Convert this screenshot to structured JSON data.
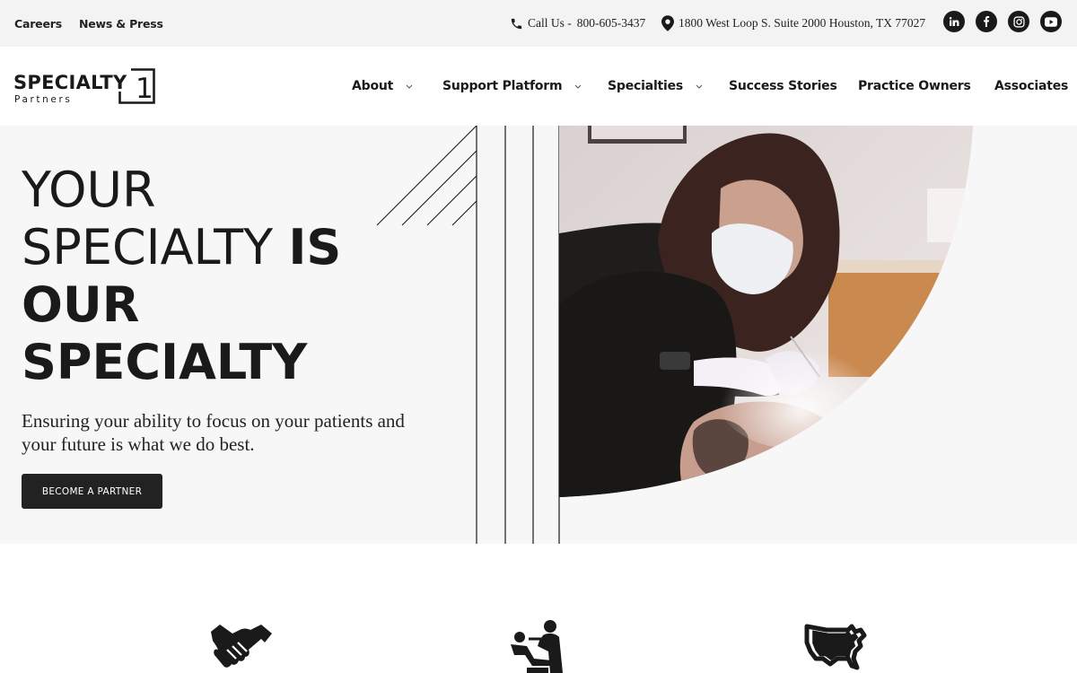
{
  "topbar": {
    "links": [
      "Careers",
      "News & Press"
    ],
    "phone_label": "Call Us -",
    "phone_number": "800-605-3437",
    "address": "1800 West Loop S. Suite 2000 Houston, TX 77027",
    "social": [
      "linkedin-icon",
      "facebook-icon",
      "instagram-icon",
      "youtube-icon"
    ]
  },
  "logo": {
    "word": "SPECIALTY",
    "number": "1",
    "sub": "Partners"
  },
  "nav": {
    "items": [
      {
        "label": "About",
        "dropdown": true
      },
      {
        "label": "Support Platform",
        "dropdown": true
      },
      {
        "label": "Specialties",
        "dropdown": true
      },
      {
        "label": "Success Stories",
        "dropdown": false
      },
      {
        "label": "Practice Owners",
        "dropdown": false
      },
      {
        "label": "Associates",
        "dropdown": false
      }
    ]
  },
  "hero": {
    "line1": "YOUR",
    "line2_thin": "SPECIALTY",
    "line2_bold": "IS",
    "line3": "OUR",
    "line4": "SPECIALTY",
    "subtext": "Ensuring your ability to focus on your patients and your future is what we do best.",
    "cta_label": "BECOME A PARTNER",
    "photo_subject": "dentist-treating-patient"
  },
  "features": {
    "icons": [
      "handshake-icon",
      "dental-chair-icon",
      "usa-map-icon"
    ]
  },
  "colors": {
    "topbar_bg": "#f4f3f3",
    "hero_bg": "#f7f7f7",
    "dark": "#1a1a1a",
    "button_bg": "#222222"
  }
}
